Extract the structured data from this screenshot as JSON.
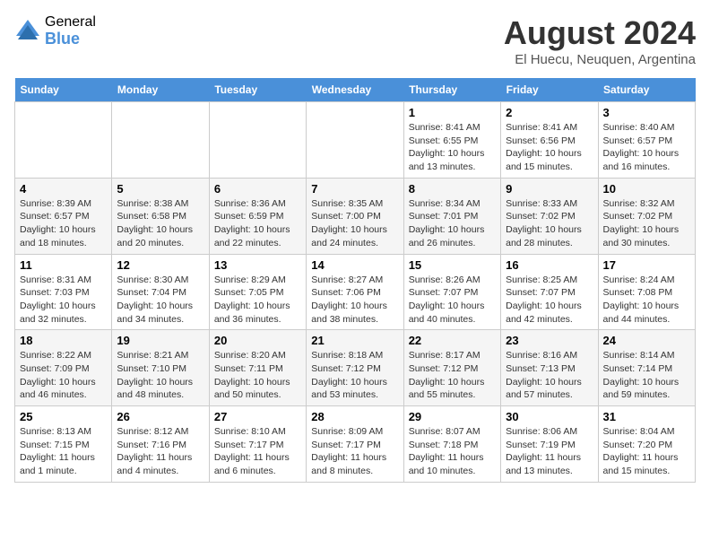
{
  "header": {
    "logo_general": "General",
    "logo_blue": "Blue",
    "title": "August 2024",
    "location": "El Huecu, Neuquen, Argentina"
  },
  "weekdays": [
    "Sunday",
    "Monday",
    "Tuesday",
    "Wednesday",
    "Thursday",
    "Friday",
    "Saturday"
  ],
  "weeks": [
    [
      {
        "day": "",
        "info": ""
      },
      {
        "day": "",
        "info": ""
      },
      {
        "day": "",
        "info": ""
      },
      {
        "day": "",
        "info": ""
      },
      {
        "day": "1",
        "info": "Sunrise: 8:41 AM\nSunset: 6:55 PM\nDaylight: 10 hours\nand 13 minutes."
      },
      {
        "day": "2",
        "info": "Sunrise: 8:41 AM\nSunset: 6:56 PM\nDaylight: 10 hours\nand 15 minutes."
      },
      {
        "day": "3",
        "info": "Sunrise: 8:40 AM\nSunset: 6:57 PM\nDaylight: 10 hours\nand 16 minutes."
      }
    ],
    [
      {
        "day": "4",
        "info": "Sunrise: 8:39 AM\nSunset: 6:57 PM\nDaylight: 10 hours\nand 18 minutes."
      },
      {
        "day": "5",
        "info": "Sunrise: 8:38 AM\nSunset: 6:58 PM\nDaylight: 10 hours\nand 20 minutes."
      },
      {
        "day": "6",
        "info": "Sunrise: 8:36 AM\nSunset: 6:59 PM\nDaylight: 10 hours\nand 22 minutes."
      },
      {
        "day": "7",
        "info": "Sunrise: 8:35 AM\nSunset: 7:00 PM\nDaylight: 10 hours\nand 24 minutes."
      },
      {
        "day": "8",
        "info": "Sunrise: 8:34 AM\nSunset: 7:01 PM\nDaylight: 10 hours\nand 26 minutes."
      },
      {
        "day": "9",
        "info": "Sunrise: 8:33 AM\nSunset: 7:02 PM\nDaylight: 10 hours\nand 28 minutes."
      },
      {
        "day": "10",
        "info": "Sunrise: 8:32 AM\nSunset: 7:02 PM\nDaylight: 10 hours\nand 30 minutes."
      }
    ],
    [
      {
        "day": "11",
        "info": "Sunrise: 8:31 AM\nSunset: 7:03 PM\nDaylight: 10 hours\nand 32 minutes."
      },
      {
        "day": "12",
        "info": "Sunrise: 8:30 AM\nSunset: 7:04 PM\nDaylight: 10 hours\nand 34 minutes."
      },
      {
        "day": "13",
        "info": "Sunrise: 8:29 AM\nSunset: 7:05 PM\nDaylight: 10 hours\nand 36 minutes."
      },
      {
        "day": "14",
        "info": "Sunrise: 8:27 AM\nSunset: 7:06 PM\nDaylight: 10 hours\nand 38 minutes."
      },
      {
        "day": "15",
        "info": "Sunrise: 8:26 AM\nSunset: 7:07 PM\nDaylight: 10 hours\nand 40 minutes."
      },
      {
        "day": "16",
        "info": "Sunrise: 8:25 AM\nSunset: 7:07 PM\nDaylight: 10 hours\nand 42 minutes."
      },
      {
        "day": "17",
        "info": "Sunrise: 8:24 AM\nSunset: 7:08 PM\nDaylight: 10 hours\nand 44 minutes."
      }
    ],
    [
      {
        "day": "18",
        "info": "Sunrise: 8:22 AM\nSunset: 7:09 PM\nDaylight: 10 hours\nand 46 minutes."
      },
      {
        "day": "19",
        "info": "Sunrise: 8:21 AM\nSunset: 7:10 PM\nDaylight: 10 hours\nand 48 minutes."
      },
      {
        "day": "20",
        "info": "Sunrise: 8:20 AM\nSunset: 7:11 PM\nDaylight: 10 hours\nand 50 minutes."
      },
      {
        "day": "21",
        "info": "Sunrise: 8:18 AM\nSunset: 7:12 PM\nDaylight: 10 hours\nand 53 minutes."
      },
      {
        "day": "22",
        "info": "Sunrise: 8:17 AM\nSunset: 7:12 PM\nDaylight: 10 hours\nand 55 minutes."
      },
      {
        "day": "23",
        "info": "Sunrise: 8:16 AM\nSunset: 7:13 PM\nDaylight: 10 hours\nand 57 minutes."
      },
      {
        "day": "24",
        "info": "Sunrise: 8:14 AM\nSunset: 7:14 PM\nDaylight: 10 hours\nand 59 minutes."
      }
    ],
    [
      {
        "day": "25",
        "info": "Sunrise: 8:13 AM\nSunset: 7:15 PM\nDaylight: 11 hours\nand 1 minute."
      },
      {
        "day": "26",
        "info": "Sunrise: 8:12 AM\nSunset: 7:16 PM\nDaylight: 11 hours\nand 4 minutes."
      },
      {
        "day": "27",
        "info": "Sunrise: 8:10 AM\nSunset: 7:17 PM\nDaylight: 11 hours\nand 6 minutes."
      },
      {
        "day": "28",
        "info": "Sunrise: 8:09 AM\nSunset: 7:17 PM\nDaylight: 11 hours\nand 8 minutes."
      },
      {
        "day": "29",
        "info": "Sunrise: 8:07 AM\nSunset: 7:18 PM\nDaylight: 11 hours\nand 10 minutes."
      },
      {
        "day": "30",
        "info": "Sunrise: 8:06 AM\nSunset: 7:19 PM\nDaylight: 11 hours\nand 13 minutes."
      },
      {
        "day": "31",
        "info": "Sunrise: 8:04 AM\nSunset: 7:20 PM\nDaylight: 11 hours\nand 15 minutes."
      }
    ]
  ]
}
